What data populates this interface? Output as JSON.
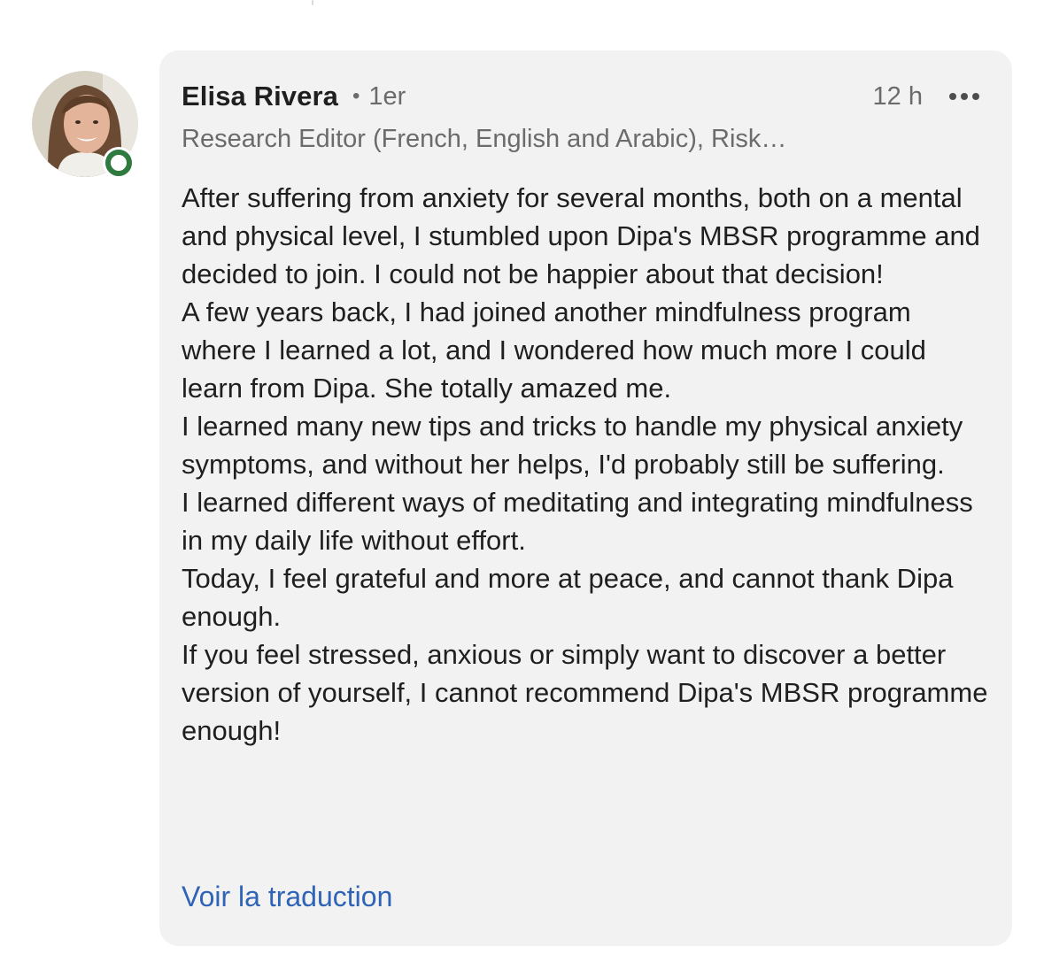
{
  "comment": {
    "author_name": "Elisa Rivera",
    "connection_degree": "1er",
    "time_ago": "12 h",
    "headline": "Research Editor (French, English and Arabic), Risk…",
    "paragraphs": [
      "After suffering from anxiety for several months, both on a mental and physical level, I stumbled upon Dipa's MBSR programme and decided to join. I could not be happier about that decision!",
      "A few years back, I had joined another mindfulness program where I learned a lot, and I wondered how much more I could learn from Dipa. She totally amazed me.",
      "I learned many new tips and tricks to handle my physical anxiety symptoms, and without her helps, I'd probably still be suffering.",
      "I learned different ways of meditating and integrating mindfulness in my daily life without effort.",
      "Today, I feel grateful and more at peace, and cannot thank Dipa enough.",
      "If you feel stressed, anxious or simply want to discover a better version of yourself, I cannot recommend Dipa's MBSR programme enough!"
    ],
    "translate_label": "Voir la traduction"
  },
  "icons": {
    "separator": "dot-separator",
    "more": "more-options-icon",
    "presence": "online-status-icon"
  },
  "colors": {
    "card_bg": "#f2f2f2",
    "presence_green": "#2f7a3e",
    "link_blue": "#2e63b6",
    "muted_text": "#6b6b6b"
  }
}
